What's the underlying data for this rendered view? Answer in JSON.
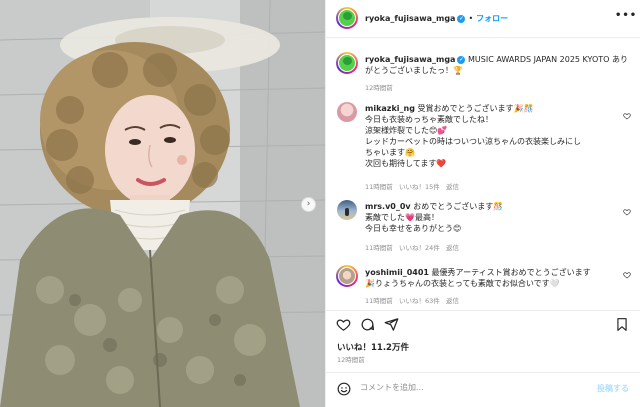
{
  "post": {
    "username": "ryoka_fujisawa_mga",
    "follow_label": "フォロー",
    "more_label": "•••",
    "caption": "MUSIC AWARDS JAPAN 2025 KYOTO ありがとうございましたっ！🏆",
    "caption_time": "12時間前",
    "likes": "いいね！11.2万件",
    "posted_time": "12時間前"
  },
  "comments": [
    {
      "username": "mikazki_ng",
      "lines": [
        "受賞おめでとうございます🎉🎊",
        "今日も衣装めっちゃ素敵でしたね！",
        "涼架様炸裂でした😊💕",
        "レッドカーペットの時はついつい涼ちゃんの衣装楽しみにし",
        "ちゃいます🤗",
        "次回も期待してます❤️"
      ],
      "time": "11時間前",
      "likes": "いいね！15件",
      "reply": "返信"
    },
    {
      "username": "mrs.v0_0v",
      "lines": [
        "おめでとうございます🎊",
        "素敵でした💗最高！",
        "今日も幸せをありがとう😊"
      ],
      "time": "11時間前",
      "likes": "いいね！24件",
      "reply": "返信"
    },
    {
      "username": "yoshimii_0401",
      "lines": [
        "最優秀アーティスト賞おめでとうございます",
        "🎉りょうちゃんの衣装とっても素敵でお似合いです🤍"
      ],
      "time": "11時間前",
      "likes": "いいね！63件",
      "reply": "返信"
    }
  ],
  "compose": {
    "placeholder": "コメントを追加...",
    "post_label": "投稿する"
  },
  "icons": {
    "emoji": "emoji-icon",
    "heart": "heart-icon",
    "comment": "comment-icon",
    "share": "share-icon",
    "bookmark": "bookmark-icon",
    "next": "chevron-right-icon",
    "verified": "verified-badge-icon"
  },
  "colors": {
    "accent": "#0095f6",
    "verified": "#1d9bf0",
    "muted": "#8e8e8e"
  }
}
